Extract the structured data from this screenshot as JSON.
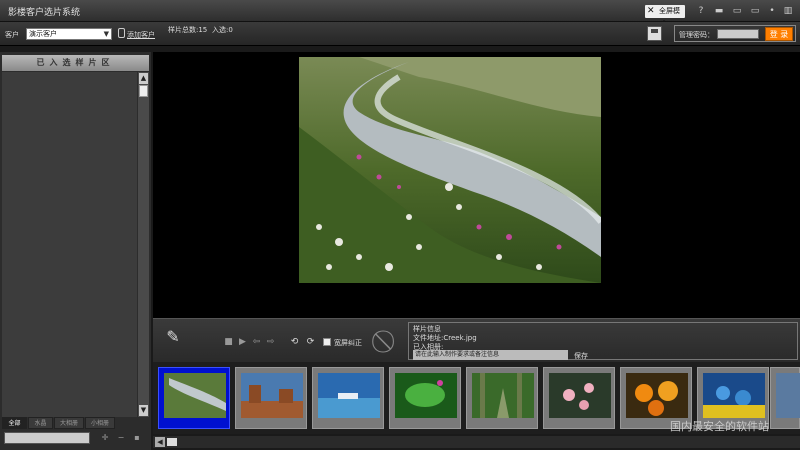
{
  "app": {
    "title": "影楼客户选片系统",
    "fullscreen_label": "全屏模式"
  },
  "toolbar": {
    "client_label": "客户",
    "client_value": "演示客户",
    "add_client_label": "添加客户",
    "sample_total_label": "样片总数:15",
    "selected_label": "入选:0",
    "admin_pwd_label": "管理密码：",
    "login_label": "登 录"
  },
  "left_panel": {
    "header": "已入选样片区",
    "tabs": [
      "全部",
      "水晶",
      "大相册",
      "小相册"
    ]
  },
  "controls": {
    "widescreen_label": "宽屏纠正"
  },
  "info": {
    "title": "样片信息",
    "file_label": "文件地址:Creek.jpg",
    "album_label": "已入相册:",
    "memo_placeholder": "请在此输入制作要求或备注信息",
    "save_label": "保存"
  },
  "thumbnails": [
    {
      "name": "creek",
      "selected": true
    },
    {
      "name": "desert",
      "selected": false
    },
    {
      "name": "lake",
      "selected": false
    },
    {
      "name": "green-leaf",
      "selected": false
    },
    {
      "name": "forest",
      "selected": false
    },
    {
      "name": "pink-flowers",
      "selected": false
    },
    {
      "name": "orange-flowers",
      "selected": false
    },
    {
      "name": "blue-flowers",
      "selected": false
    },
    {
      "name": "partial",
      "selected": false
    }
  ],
  "watermark": "国内最安全的软件站"
}
